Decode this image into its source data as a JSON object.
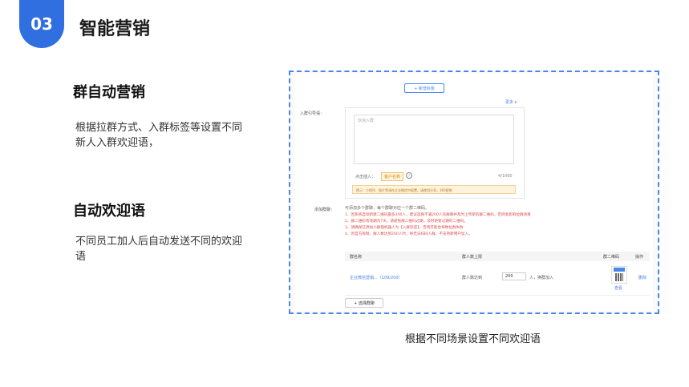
{
  "header": {
    "badge": "03",
    "title": "智能营销"
  },
  "sections": [
    {
      "heading": "群自动营销",
      "body": "根据拉群方式、入群标签等设置不同新人入群欢迎语，"
    },
    {
      "heading": "自动欢迎语",
      "body": "不同员工加人后自动发送不同的欢迎语"
    }
  ],
  "caption": "根据不同场景设置不同欢迎语",
  "screenshot": {
    "add_tag_button": "+ 新增标签",
    "more_link": "更多",
    "welcome_label": "入群引导语：",
    "textarea_placeholder": "欢迎入群",
    "insert_label": "点击插入：",
    "insert_tag": "客户名称",
    "counter": "4/1000",
    "tip": "提示：小程序、图片等请在企业微信中配置，请使用分享。360营销",
    "add_group_label": "添加群聊：",
    "rules_head": "可添加多个群聊，每个群聊对应一个群二维码。",
    "rules": [
      "1、因系统自动新建二维码最多200人，建议选择不满200人的群聊并及时上传新的群二维码，否则会影响拉群效果",
      "2、群二维码有效期为7天，请避免群二维码过期，及时更新过期的二维码。",
      "3、请确保已添加小助理机器人为【入群欢迎】，否则可能会导致拉群失败",
      "4、因官方限制，群人数达到200人时，将无法扫码入群，不支持新用户加入。"
    ],
    "table": {
      "headers": [
        "群名称",
        "群人数上限",
        "群二维码",
        "操作"
      ],
      "rows": [
        {
          "name": "企业微信营销...（109/200）",
          "limit_prefix": "群人数达到",
          "limit_value": "200",
          "limit_suffix": "人，换群加入",
          "qr_action": "查看",
          "action": "删除"
        }
      ]
    },
    "select_group_button": "+ 选择群聊"
  }
}
